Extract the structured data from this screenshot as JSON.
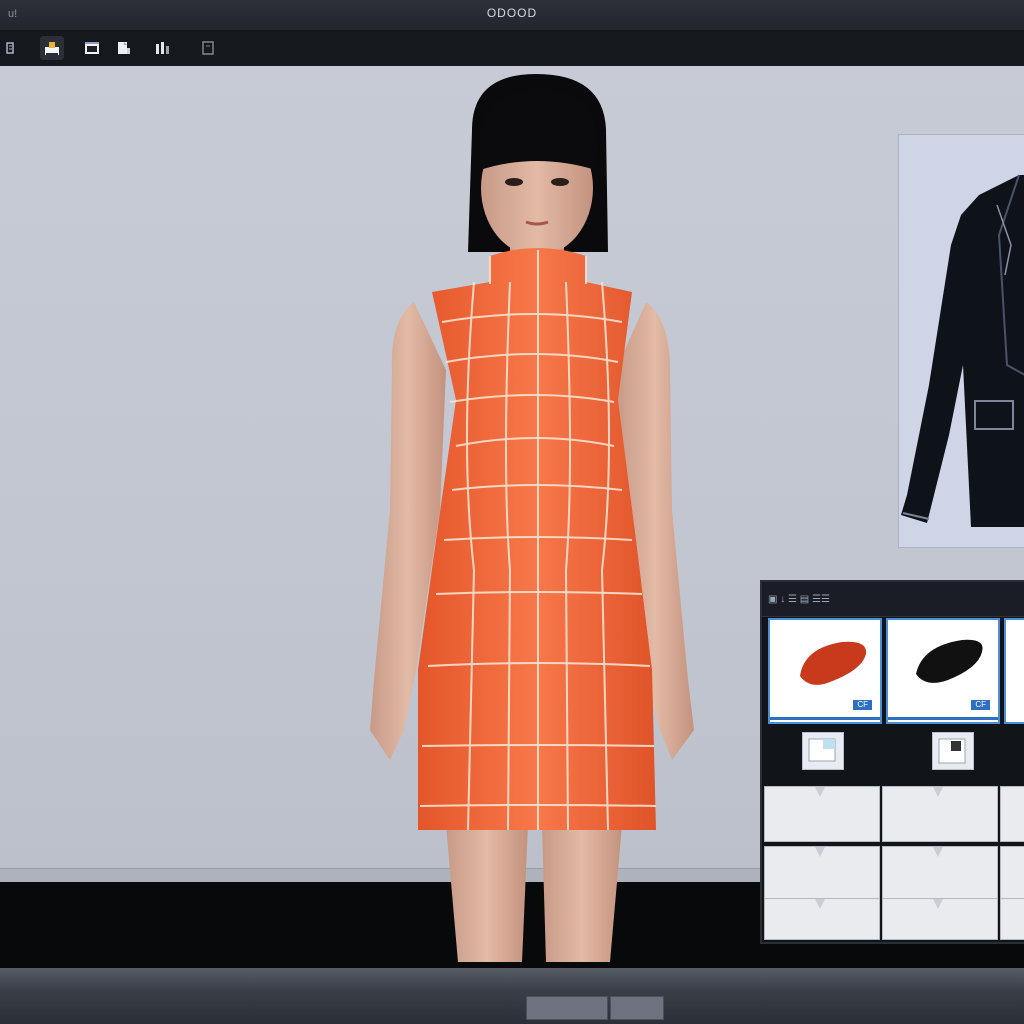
{
  "window": {
    "title": "ODOOD",
    "sys_mark": "u!"
  },
  "toolbar": {
    "items": [
      {
        "name": "panel-icon"
      },
      {
        "name": "home-icon"
      },
      {
        "name": "image-icon"
      },
      {
        "name": "file-icon"
      },
      {
        "name": "bars-icon"
      },
      {
        "name": "frame-icon"
      }
    ]
  },
  "library": {
    "header": "▣ ↓ ☰ ▤ ☰☰",
    "items": [
      {
        "tag": "CF",
        "color": "#c9391c"
      },
      {
        "tag": "CF",
        "color": "#111111"
      }
    ]
  },
  "colors": {
    "dress": "#f26b3a",
    "grid_lines": "#fde2cf",
    "jacket": "#0e1219",
    "accent": "#2d6fc0"
  }
}
